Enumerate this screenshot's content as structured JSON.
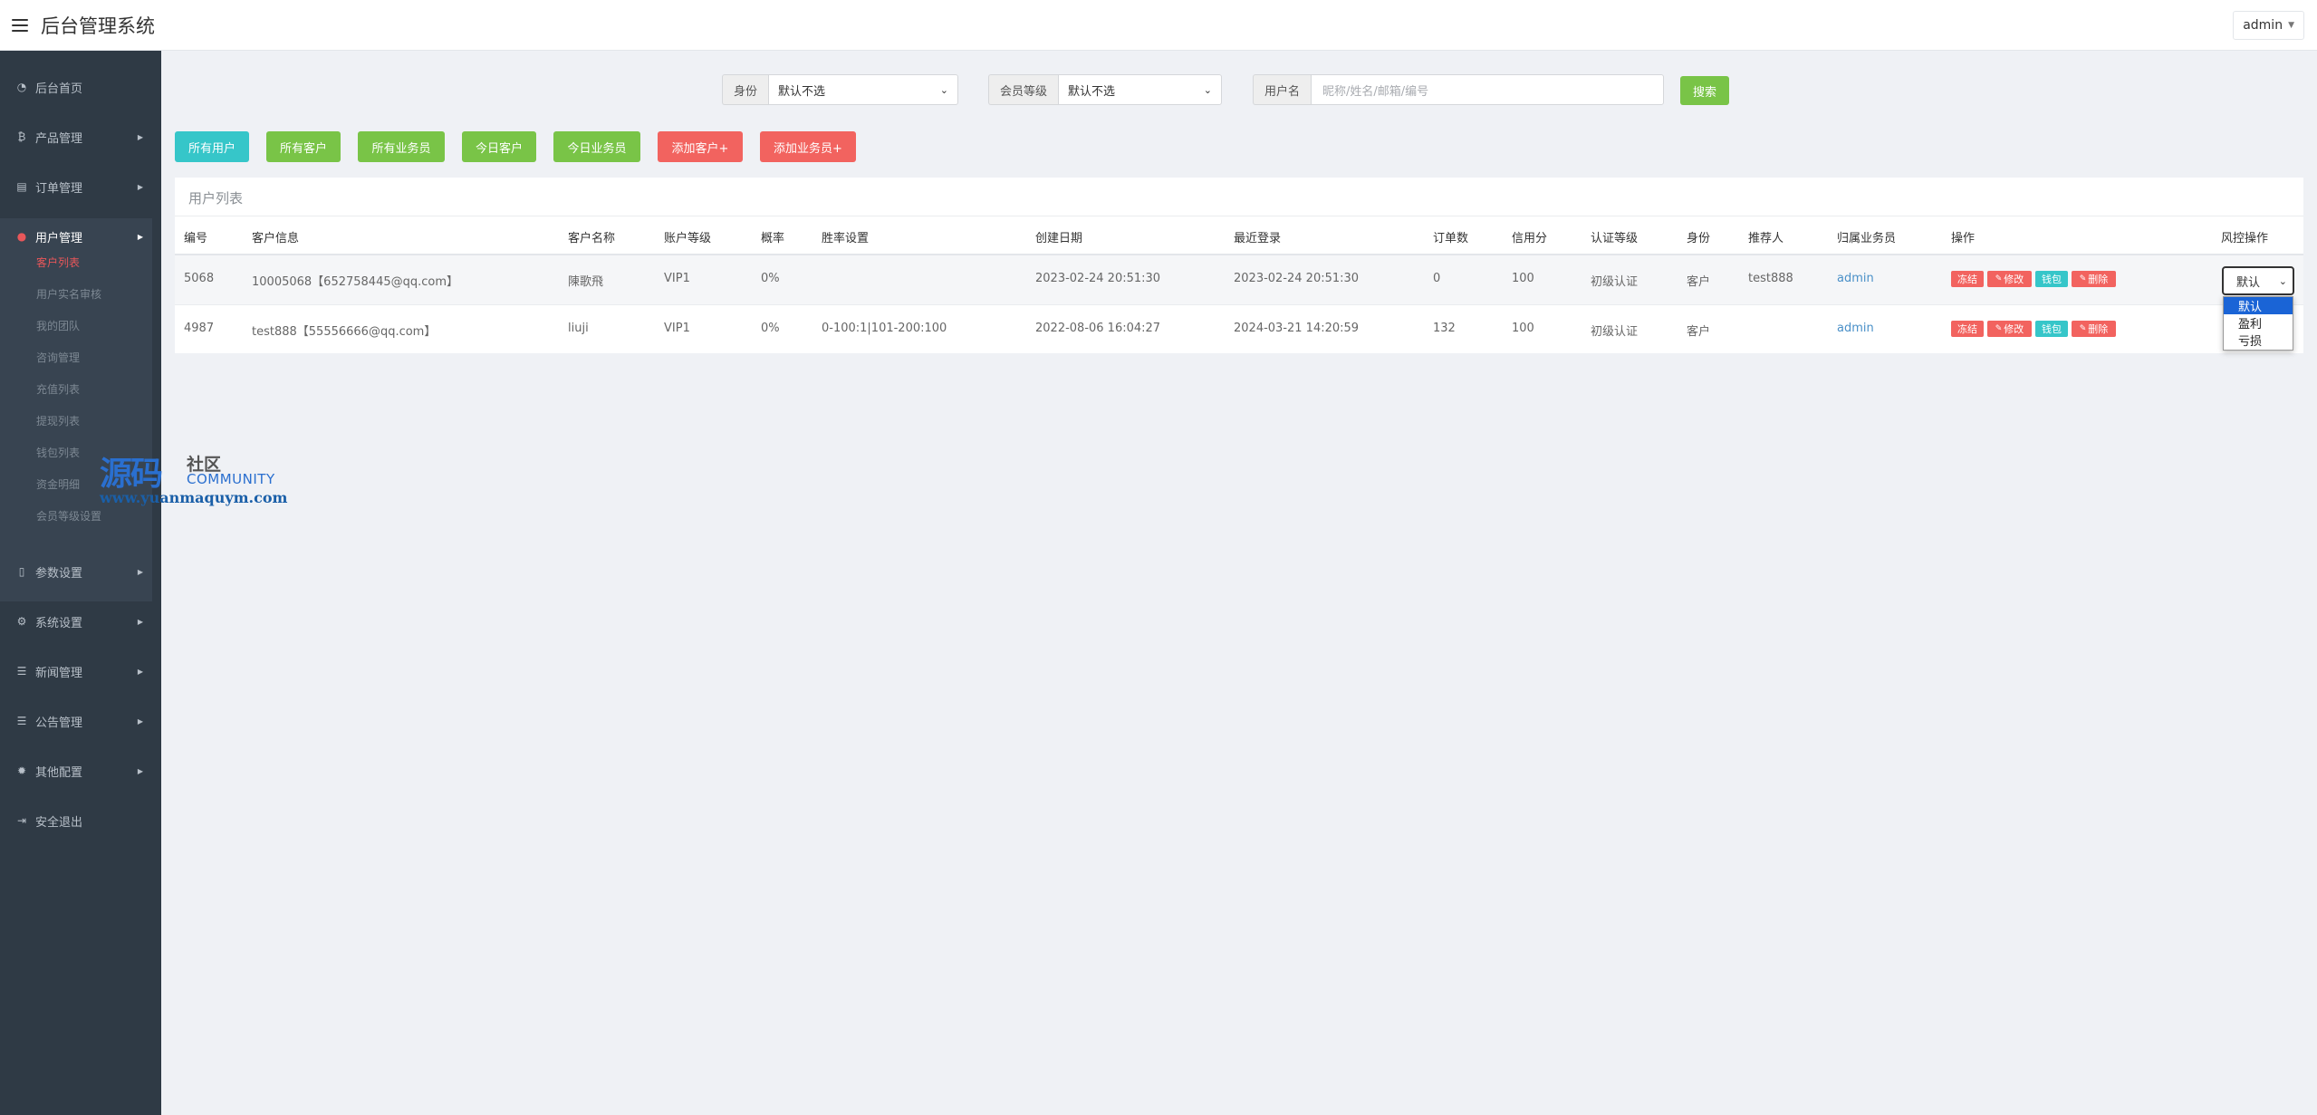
{
  "header": {
    "title": "后台管理系统",
    "user": "admin"
  },
  "sidebar": {
    "items": [
      {
        "label": "后台首页",
        "icon": "dashboard-icon"
      },
      {
        "label": "产品管理",
        "icon": "bitcoin-icon"
      },
      {
        "label": "订单管理",
        "icon": "order-icon"
      },
      {
        "label": "用户管理",
        "icon": "user-icon"
      },
      {
        "label": "参数设置",
        "icon": "file-icon"
      },
      {
        "label": "系统设置",
        "icon": "cogs-icon"
      },
      {
        "label": "新闻管理",
        "icon": "list-icon"
      },
      {
        "label": "公告管理",
        "icon": "list-icon"
      },
      {
        "label": "其他配置",
        "icon": "gear-icon"
      },
      {
        "label": "安全退出",
        "icon": "logout-icon"
      }
    ],
    "submenu": [
      "客户列表",
      "用户实名审核",
      "我的团队",
      "咨询管理",
      "充值列表",
      "提现列表",
      "钱包列表",
      "资金明细",
      "会员等级设置"
    ]
  },
  "filters": {
    "identity_label": "身份",
    "identity_value": "默认不选",
    "level_label": "会员等级",
    "level_value": "默认不选",
    "username_label": "用户名",
    "username_placeholder": "昵称/姓名/邮箱/编号",
    "search_label": "搜索"
  },
  "quick_buttons": [
    "所有用户",
    "所有客户",
    "所有业务员",
    "今日客户",
    "今日业务员",
    "添加客户+",
    "添加业务员+"
  ],
  "table": {
    "title": "用户列表",
    "columns": [
      "编号",
      "客户信息",
      "客户名称",
      "账户等级",
      "概率",
      "胜率设置",
      "创建日期",
      "最近登录",
      "订单数",
      "信用分",
      "认证等级",
      "身份",
      "推荐人",
      "归属业务员",
      "操作",
      "风控操作"
    ],
    "rows": [
      {
        "id": "5068",
        "info": "10005068【652758445@qq.com】",
        "name": "陳歌飛",
        "level": "VIP1",
        "prob": "0%",
        "win_setting": "",
        "created": "2023-02-24 20:51:30",
        "last_login": "2023-02-24 20:51:30",
        "orders": "0",
        "credit": "100",
        "auth": "初级认证",
        "role": "客户",
        "referrer": "test888",
        "agent": "admin"
      },
      {
        "id": "4987",
        "info": "test888【55556666@qq.com】",
        "name": "liuji",
        "level": "VIP1",
        "prob": "0%",
        "win_setting": "0-100:1|101-200:100",
        "created": "2022-08-06 16:04:27",
        "last_login": "2024-03-21 14:20:59",
        "orders": "132",
        "credit": "100",
        "auth": "初级认证",
        "role": "客户",
        "referrer": "",
        "agent": "admin"
      }
    ],
    "actions": {
      "freeze": "冻结",
      "edit": "修改",
      "wallet": "钱包",
      "delete": "删除"
    },
    "risk": {
      "value": "默认",
      "options": [
        "默认",
        "盈利",
        "亏损"
      ]
    }
  },
  "watermark": {
    "main": "源码",
    "cn": "社区",
    "en": "COMMUNITY",
    "url": "www.yuanmaquym.com"
  },
  "colors": {
    "sidebar": "#2f3a45",
    "green": "#79c447",
    "teal": "#36c6c9",
    "red": "#f2635f",
    "link": "#4a90c8"
  }
}
